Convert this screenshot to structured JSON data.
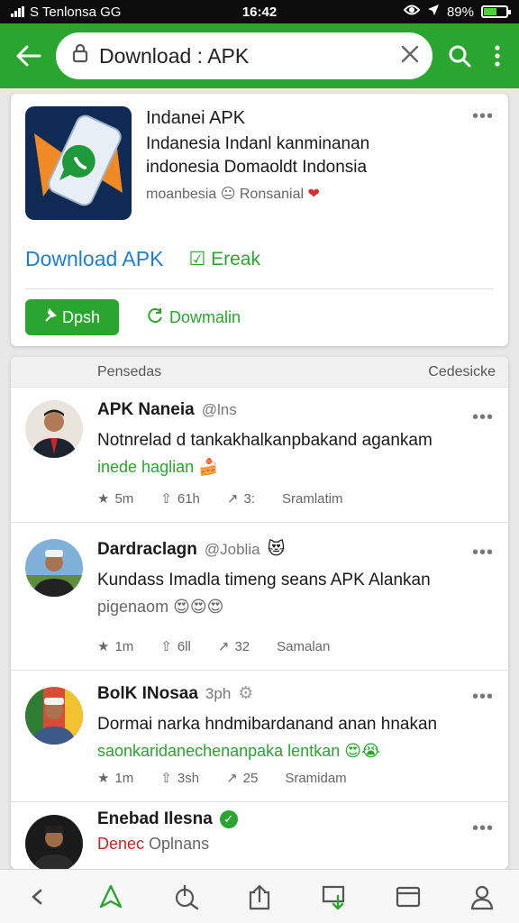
{
  "status_bar": {
    "carrier": "S Tenlonsa GG",
    "time": "16:42",
    "battery": "89%",
    "battery_fraction": 0.6
  },
  "toolbar": {
    "url": "Download : APK",
    "accent": "#2aa52f"
  },
  "app": {
    "name": "Indanei APK",
    "line2": "Indanesia Indanl kanminanan",
    "line3": "indonesia Domaoldt Indonsia",
    "meta": "moanbesia",
    "meta_region": "Ronsanial",
    "link_download": "Download APK",
    "link_check": "Ereak",
    "open_button": "Dpsh",
    "download_link": "Dowmalin"
  },
  "feed": {
    "header_left": "Pensedas",
    "header_right": "Cedesicke",
    "posts": [
      {
        "name": "APK Naneia",
        "handle": "@lns",
        "text": "Notnrelad d tankakhalkanpbakand agankam",
        "sub": "inede haglian",
        "sub_emoji": "🍰",
        "likes": "5m",
        "shares": "61h",
        "comments": "3:",
        "label": "Sramlatim"
      },
      {
        "name": "Dardraclagn",
        "handle": "@Joblia",
        "handle_emoji": "😻",
        "text": "Kundass Imadla timeng seans APK Alankan",
        "sub": "pigenaom",
        "sub_emoji": "😍😍😍",
        "likes": "1m",
        "shares": "6ll",
        "comments": "32",
        "label": "Samalan"
      },
      {
        "name": "BolK INosaa",
        "handle": "3ph",
        "text": "Dormai narka hndmibardanand anan hnakan",
        "sub": "saonkaridanechenanpaka lentkan",
        "sub_emoji": "😍😭",
        "likes": "1m",
        "shares": "3sh",
        "comments": "25",
        "label": "Sramidam"
      },
      {
        "name": "Enebad Ilesna",
        "verified": "✓",
        "sub_red": "Denec",
        "sub_grey": "Oplnans"
      }
    ]
  },
  "icons": {
    "back": "arrow-left-icon",
    "search": "search-icon",
    "menu": "more-vertical-icon",
    "lock": "lock-icon",
    "clear": "close-icon"
  }
}
